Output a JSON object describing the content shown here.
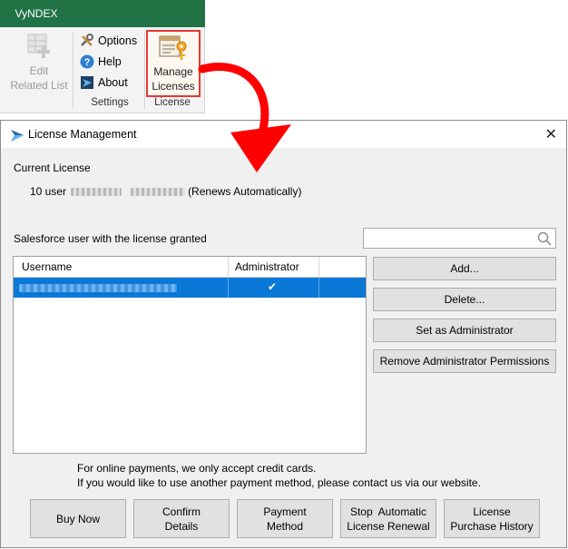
{
  "ribbon": {
    "tab": "VyNDEX",
    "edit_related_list": [
      "Edit",
      "Related List"
    ],
    "options": "Options",
    "help": "Help",
    "about": "About",
    "settings_group": "Settings",
    "manage_licenses": [
      "Manage",
      "Licenses"
    ],
    "license_group": "License"
  },
  "dialog": {
    "title": "License Management",
    "current_license_label": "Current License",
    "license_prefix": "10 user",
    "license_suffix": "(Renews Automatically)",
    "granted_label": "Salesforce user with the license granted",
    "search": {
      "placeholder": "",
      "value": ""
    },
    "columns": [
      "Username",
      "Administrator"
    ],
    "rows": [
      {
        "username": "",
        "administrator": "✔"
      }
    ],
    "side_buttons": {
      "add": "Add...",
      "delete": "Delete...",
      "set_admin": "Set as Administrator",
      "remove_admin": "Remove Administrator Permissions"
    },
    "payment_note_1": "For online payments, we only accept credit cards.",
    "payment_note_2": "If you would like to use another payment method, please contact us via our website.",
    "bottom_buttons": {
      "buy_now": "Buy Now",
      "confirm_details": [
        "Confirm",
        "Details"
      ],
      "payment_method": [
        "Payment",
        "Method"
      ],
      "stop_renewal": [
        "Stop  Automatic",
        "License Renewal"
      ],
      "purchase_history": [
        "License",
        "Purchase History"
      ]
    },
    "close_glyph": "✕"
  },
  "colors": {
    "ribbon_green": "#217346",
    "highlight_red": "#e53935",
    "selection_blue": "#0a78d7",
    "arrow_red": "#ff0000"
  }
}
